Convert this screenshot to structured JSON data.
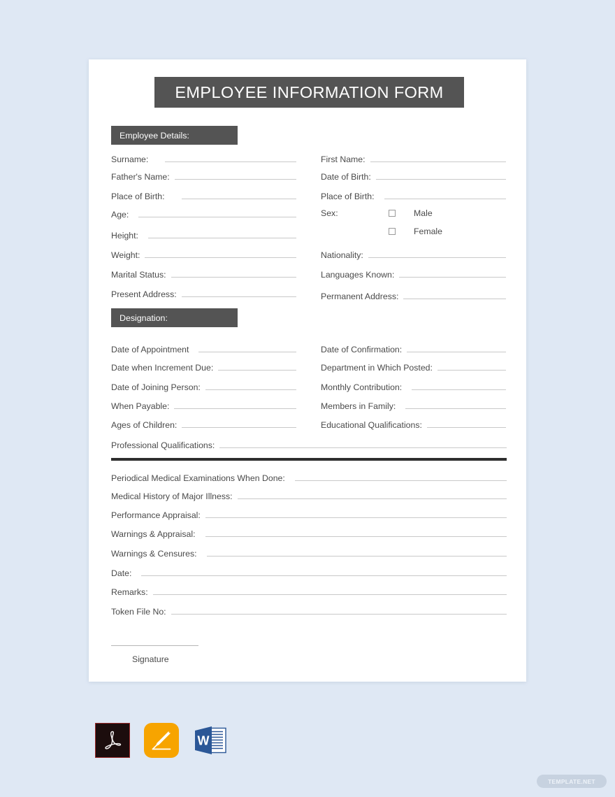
{
  "background_color": "#dfe8f4",
  "page": {
    "title": "EMPLOYEE INFORMATION FORM",
    "title_bar_color": "#545454",
    "card_color": "#ffffff"
  },
  "sections": {
    "employee_details": {
      "heading": "Employee Details:",
      "left_fields": [
        {
          "label": "Surname:"
        },
        {
          "label": "Father's Name:"
        },
        {
          "label": "Place of Birth:"
        },
        {
          "label": "Age:"
        },
        {
          "label": "Height:"
        },
        {
          "label": "Weight:"
        },
        {
          "label": "Marital Status:"
        },
        {
          "label": "Present Address:"
        }
      ],
      "right_fields": [
        {
          "label": "First Name:"
        },
        {
          "label": "Date of Birth:"
        },
        {
          "label": "Place of Birth:"
        },
        {
          "label": "Nationality:"
        },
        {
          "label": "Languages Known:"
        },
        {
          "label": "Permanent Address:"
        }
      ],
      "sex": {
        "label": "Sex:",
        "options": [
          {
            "label": "Male",
            "checked": false
          },
          {
            "label": "Female",
            "checked": false
          }
        ]
      }
    },
    "designation": {
      "heading": "Designation:",
      "left_fields": [
        {
          "label": "Date of Appointment"
        },
        {
          "label": "Date when Increment Due:"
        },
        {
          "label": "Date of Joining Person:"
        },
        {
          "label": "When Payable:"
        },
        {
          "label": "Ages of Children:"
        }
      ],
      "right_fields": [
        {
          "label": "Date of Confirmation:"
        },
        {
          "label": "Department in Which Posted:"
        },
        {
          "label": "Monthly Contribution:"
        },
        {
          "label": "Members in Family:"
        },
        {
          "label": "Educational Qualifications:"
        }
      ],
      "full_fields": [
        {
          "label": "Professional Qualifications:"
        }
      ]
    },
    "records": {
      "divider_color": "#2e2e2e",
      "full_fields": [
        {
          "label": "Periodical Medical Examinations When Done:"
        },
        {
          "label": "Medical History of Major Illness:"
        },
        {
          "label": "Performance Appraisal:"
        },
        {
          "label": "Warnings & Appraisal:"
        },
        {
          "label": "Warnings & Censures:"
        },
        {
          "label": "Date:"
        },
        {
          "label": "Remarks:"
        },
        {
          "label": "Token File No:"
        }
      ]
    },
    "signature": {
      "caption": "Signature"
    }
  },
  "format_icons": [
    {
      "name": "pdf-icon",
      "letter": "",
      "label": "PDF"
    },
    {
      "name": "apple-pages-icon",
      "letter": "",
      "label": "Pages"
    },
    {
      "name": "word-icon",
      "letter": "W",
      "label": "Word"
    }
  ],
  "watermark": {
    "text": "TEMPLATE.NET"
  }
}
